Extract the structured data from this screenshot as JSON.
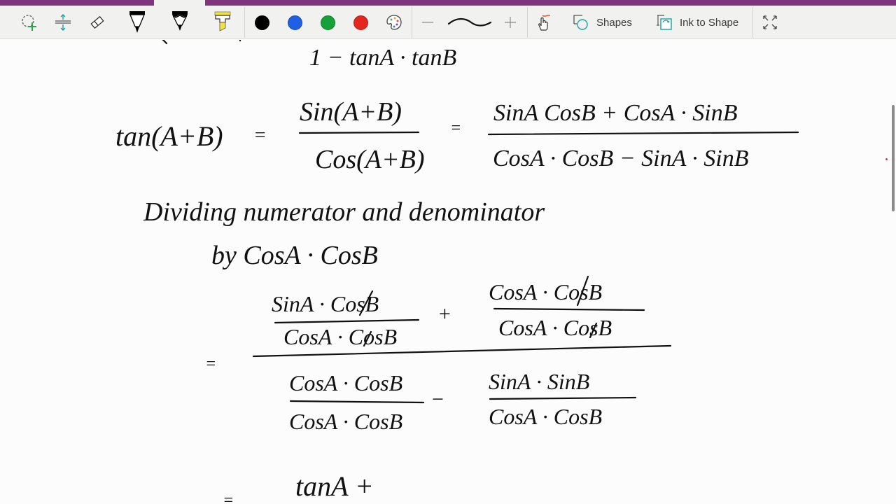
{
  "window": {
    "accent_color": "#7e357d"
  },
  "toolbar": {
    "tools": [
      {
        "name": "lasso-select",
        "icon": "lasso-select-icon"
      },
      {
        "name": "add-space",
        "icon": "add-space-icon"
      },
      {
        "name": "eraser",
        "icon": "eraser-icon"
      },
      {
        "name": "pen",
        "icon": "pen-icon"
      },
      {
        "name": "pencil",
        "icon": "pencil-icon"
      },
      {
        "name": "highlighter",
        "icon": "highlighter-icon"
      }
    ],
    "colors": [
      {
        "name": "black",
        "hex": "#000000"
      },
      {
        "name": "blue",
        "hex": "#1f5fe6"
      },
      {
        "name": "green",
        "hex": "#16a038"
      },
      {
        "name": "red",
        "hex": "#e3261e"
      }
    ],
    "more_colors_icon": "palette-icon",
    "thickness": {
      "decrease_icon": "minus-icon",
      "preview_icon": "stroke-preview-icon",
      "increase_icon": "plus-icon"
    },
    "touch_draw_icon": "touch-drawing-icon",
    "shapes_label": "Shapes",
    "ink_to_shape_label": "Ink to Shape",
    "fullscreen_icon": "fullscreen-icon"
  },
  "canvas": {
    "lines": {
      "top_partial": "1 − tanA · tanB",
      "eq1_lhs": "tan(A+B)",
      "eq1_equals": "=",
      "eq1_num": "Sin(A+B)",
      "eq1_den": "Cos(A+B)",
      "eq1_equals2": "=",
      "eq1_rhs_num": "SinA CosB + CosA · SinB",
      "eq1_rhs_den": "CosA · CosB − SinA · SinB",
      "note_line1": "Dividing numerator and denominator",
      "note_line2": "by CosA · CosB",
      "eq2_equals": "=",
      "eq2_t1_num": "SinA · CosB",
      "eq2_t1_den": "CosA · CosB",
      "eq2_plus": "+",
      "eq2_t2_num": "CosA · CosB",
      "eq2_t2_den": "CosA · CosB",
      "eq2_t3_num": "CosA · CosB",
      "eq2_t3_den": "CosA · CosB",
      "eq2_minus": "−",
      "eq2_t4_num": "SinA · SinB",
      "eq2_t4_den": "CosA · CosB",
      "eq3_equals": "=",
      "eq3_partial": "tanA +"
    }
  }
}
